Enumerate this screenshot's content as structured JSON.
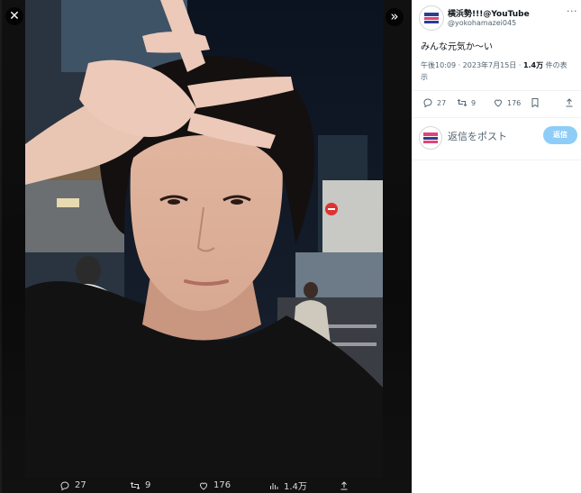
{
  "viewer": {
    "close_label": "✕",
    "expand_label": "»",
    "actions": [
      {
        "icon": "reply-icon",
        "count": "27"
      },
      {
        "icon": "retweet-icon",
        "count": "9"
      },
      {
        "icon": "like-icon",
        "count": "176"
      },
      {
        "icon": "views-icon",
        "count": "1.4万"
      },
      {
        "icon": "share-icon",
        "count": ""
      }
    ]
  },
  "tweet": {
    "author_name": "横浜勢!!!@YouTube",
    "author_handle": "@yokohamazei045",
    "more_label": "···",
    "text": "みんな元気か〜い",
    "meta_time": "午後10:09 · 2023年7月15日 · ",
    "meta_views_count": "1.4万",
    "meta_views_label": " 件の表示",
    "actions": [
      {
        "icon": "reply-icon",
        "count": "27"
      },
      {
        "icon": "retweet-icon",
        "count": "9"
      },
      {
        "icon": "like-icon",
        "count": "176"
      },
      {
        "icon": "bookmark-icon",
        "count": ""
      },
      {
        "icon": "share-icon",
        "count": ""
      }
    ]
  },
  "reply": {
    "placeholder": "返信をポスト",
    "button_label": "返信"
  },
  "colors": {
    "accent": "#1d9bf0",
    "reply_button_disabled": "#8ecdf8",
    "text_secondary": "#536471"
  }
}
